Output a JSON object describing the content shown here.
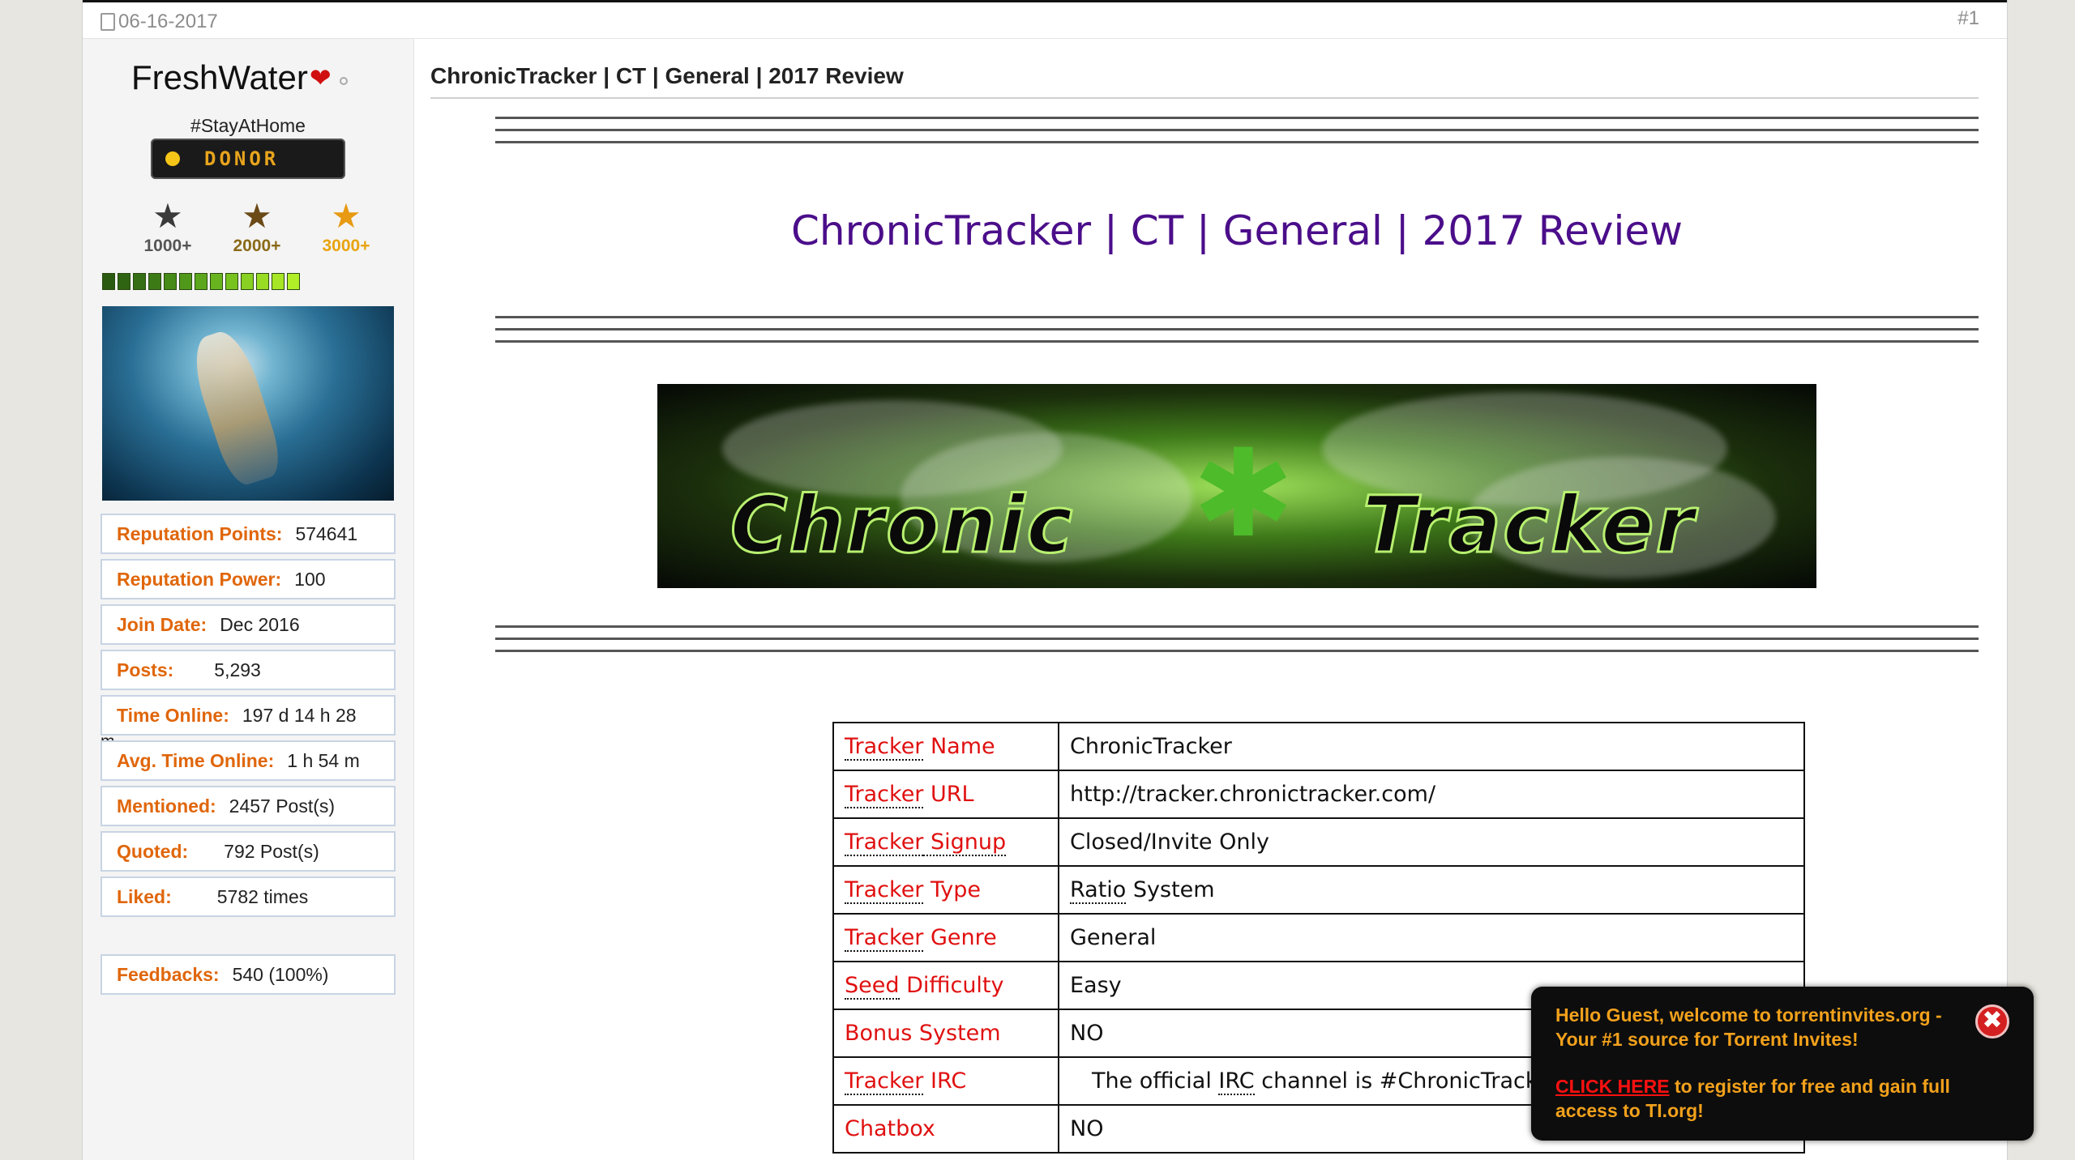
{
  "post": {
    "date": "06-16-2017",
    "number": "#1",
    "title": "ChronicTracker | CT | General | 2017 Review"
  },
  "user": {
    "name": "FreshWater",
    "title": "#StayAtHome",
    "donor_badge": "DONOR",
    "milestones": [
      "1000+",
      "2000+",
      "3000+"
    ],
    "reputation_level": {
      "filled": 13,
      "total": 13
    },
    "stats": [
      {
        "label": "Reputation Points:",
        "value": "574641"
      },
      {
        "label": "Reputation Power:",
        "value": "100"
      },
      {
        "label": "Join Date:",
        "value": "Dec 2016"
      },
      {
        "label": "Posts:",
        "value": "5,293"
      },
      {
        "label": "Time Online:",
        "value": "197 d 14 h 28",
        "wrap": "m"
      },
      {
        "label": "Avg. Time Online:",
        "value": "1 h 54 m"
      },
      {
        "label": "Mentioned:",
        "value": "2457 Post(s)"
      },
      {
        "label": "Quoted:",
        "value": "792 Post(s)"
      },
      {
        "label": "Liked:",
        "value": "5782 times"
      },
      {
        "label": "Feedbacks:",
        "value": "540 (100%)"
      }
    ]
  },
  "review": {
    "heading": "ChronicTracker | CT | General | 2017 Review",
    "banner_words": [
      "Chronic",
      "Tracker"
    ],
    "table": [
      {
        "k1": "Tracker",
        "k2": " Name",
        "value": "ChronicTracker"
      },
      {
        "k1": "Tracker",
        "k2": " URL",
        "value": "http://tracker.chronictracker.com/"
      },
      {
        "k1": "Tracker",
        "k2": " Signup",
        "value": "Closed/Invite Only"
      },
      {
        "k1": "Tracker",
        "k2": " Type",
        "v1": "Ratio",
        "v2": " System"
      },
      {
        "k1": "Tracker",
        "k2": " Genre",
        "value": "General"
      },
      {
        "k1": "Seed",
        "k2": " Difficulty",
        "value": "Easy"
      },
      {
        "k1": "",
        "k2": "Bonus System",
        "value": "NO"
      },
      {
        "k1": "Tracker",
        "k2": " IRC",
        "v0": "The official ",
        "v1": "IRC",
        "v2": " channel is #ChronicTracker on the "
      },
      {
        "k1": "",
        "k2": "Chatbox",
        "value": "NO"
      }
    ]
  },
  "popup": {
    "greeting": "Hello Guest, welcome to torrentinvites.org - Your #1 source for Torrent Invites!",
    "cta_link": "CLICK HERE",
    "cta_text": " to register for free and gain full access to TI.org!",
    "close_glyph": "✖"
  }
}
